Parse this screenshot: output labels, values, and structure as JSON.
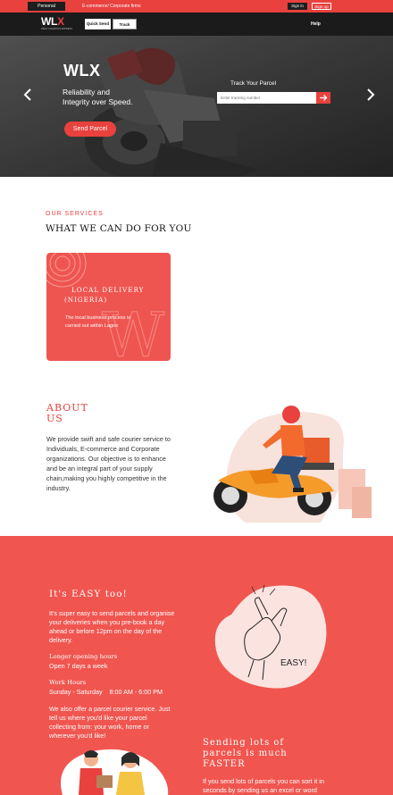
{
  "topbar": {
    "personal_label": "Personal",
    "ecommerce_label": "E-commerce/ Corporate firms",
    "signin_label": "Sign in",
    "signup_label": "Sign up"
  },
  "nav": {
    "logo_main": "WL",
    "logo_accent": "X",
    "logo_sub": "WEST LOGISTICS EXPRESS",
    "quick_send_label": "Quick Send",
    "track_label": "Track",
    "help_label": "Help"
  },
  "hero": {
    "title": "WLX",
    "tagline_line1": "Reliability and",
    "tagline_line2": "Integrity over Speed.",
    "cta_label": "Send Parcel",
    "track_heading": "Track Your Parcel",
    "track_placeholder": "Enter tracking number"
  },
  "services": {
    "eyebrow": "OUR SERVICES",
    "heading": "WHAT WE CAN DO FOR YOU",
    "card": {
      "title_line1": "LOCAL DELIVERY",
      "title_line2": "(NIGERIA)",
      "desc_line1": "The local business process is",
      "desc_line2": "carried out within Lagos"
    }
  },
  "about": {
    "heading_line1": "ABOUT",
    "heading_line2": "US",
    "lines": [
      "We provide swift and safe courier service to",
      "Individuals, E-commerce and Corporate",
      "organizations. Our objective is to enhance",
      "and be an integral part of your supply",
      "chain,making you highly competitive in the",
      "industry."
    ]
  },
  "easy": {
    "heading": "It's EASY too!",
    "intro_lines": [
      "It's super easy to send parcels and organise",
      "your deliveries when you pre-book a day",
      "ahead or before 12pm on the day of the",
      "delivery."
    ],
    "hours_label": "Longer opening hours",
    "hours_value": "Open 7 days a week",
    "work_label": "Work Hours",
    "work_value": "Sunday - Saturday    8:00 AM - 6:00 PM",
    "collect_lines": [
      "We also offer a parcel courier service. Just",
      "tell us where you'd like your parcel",
      "collecting from: your work, home or",
      "wherever you'd like!"
    ],
    "illustration_caption": "EASY!"
  },
  "faster": {
    "heading_lines": [
      "Sending lots of",
      "parcels is much",
      "FASTER"
    ],
    "body_lines": [
      "If you send lots of parcels you can sort it in",
      "seconds by sending us an excel or word"
    ]
  },
  "colors": {
    "brand_red": "#e8413e",
    "dark": "#1b1b1b",
    "section_red": "#f0554f"
  }
}
